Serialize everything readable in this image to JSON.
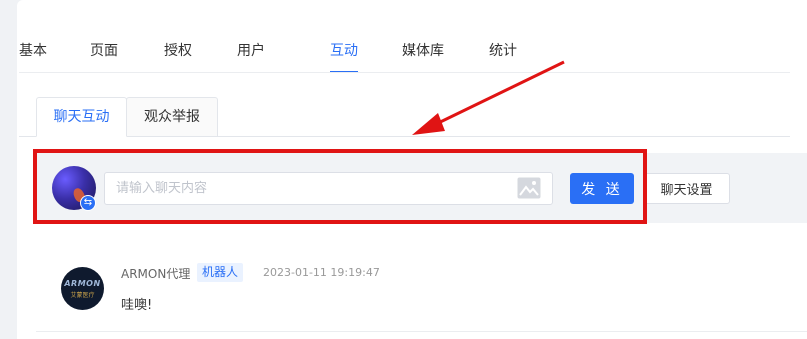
{
  "main_tabs": [
    "基本",
    "页面",
    "授权",
    "用户",
    "互动",
    "媒体库",
    "统计"
  ],
  "main_active_index": 4,
  "sub_tabs": [
    "聊天互动",
    "观众举报"
  ],
  "sub_active_index": 0,
  "chat_bar": {
    "placeholder": "请输入聊天内容",
    "send_label": "发 送",
    "settings_label": "聊天设置"
  },
  "icons": {
    "image": "image-upload-icon",
    "switch": "switch-identity-icon"
  },
  "message": {
    "avatar_line1": "ARMON",
    "avatar_line2": "艾蒙医疗",
    "name": "ARMON代理",
    "badge": "机器人",
    "time": "2023-01-11 19:19:47",
    "text": "哇噢!"
  },
  "colors": {
    "accent": "#2a6ff5",
    "annotation": "#e01414"
  }
}
